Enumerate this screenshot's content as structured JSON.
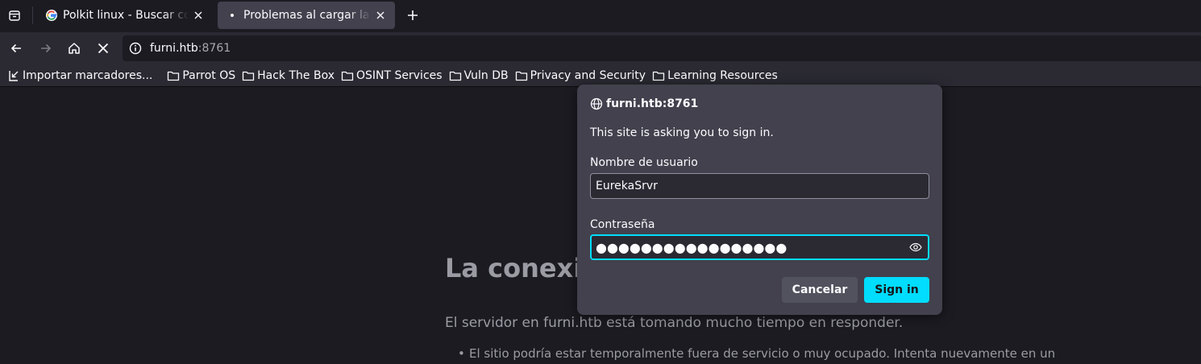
{
  "tabs": [
    {
      "title": "Polkit linux - Buscar con Google",
      "favicon": "google-icon",
      "active": false
    },
    {
      "title": "Problemas al cargar la página",
      "favicon": "loading-dot-icon",
      "active": true
    }
  ],
  "navbar": {
    "url_host": "furni.htb",
    "url_port": ":8761",
    "loading": true
  },
  "bookmarks": [
    {
      "label": "Importar marcadores...",
      "icon": "import-icon"
    },
    {
      "label": "Parrot OS",
      "icon": "folder-icon"
    },
    {
      "label": "Hack The Box",
      "icon": "folder-icon"
    },
    {
      "label": "OSINT Services",
      "icon": "folder-icon"
    },
    {
      "label": "Vuln DB",
      "icon": "folder-icon"
    },
    {
      "label": "Privacy and Security",
      "icon": "folder-icon"
    },
    {
      "label": "Learning Resources",
      "icon": "folder-icon"
    }
  ],
  "error_page": {
    "title": "La conexión ha caducado",
    "description": "El servidor en furni.htb está tomando mucho tiempo en responder.",
    "bullet_1": "El sitio podría estar temporalmente fuera de servicio o muy ocupado. Intenta nuevamente en un"
  },
  "auth_dialog": {
    "origin": "furni.htb:8761",
    "message": "This site is asking you to sign in.",
    "username_label": "Nombre de usuario",
    "username_value": "EurekaSrvr",
    "password_label": "Contraseña",
    "password_masked": "●●●●●●●●●●●●●●●●●",
    "cancel_label": "Cancelar",
    "signin_label": "Sign in"
  },
  "colors": {
    "accent": "#00ddff",
    "dialog_bg": "#42414d",
    "page_bg": "#1c1b22",
    "toolbar_bg": "#2b2a33"
  }
}
